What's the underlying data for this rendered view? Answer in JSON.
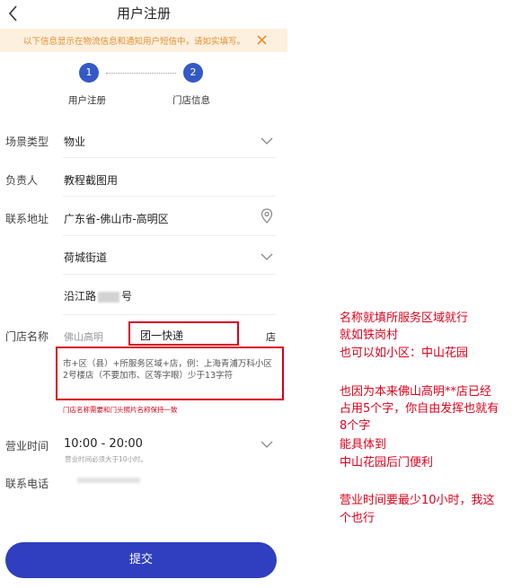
{
  "header": {
    "title": "用户注册"
  },
  "notice": {
    "text": "以下信息显示在物流信息和通知用户短信中，请如实填写。"
  },
  "steps": [
    {
      "number": "1",
      "label": "用户注册"
    },
    {
      "number": "2",
      "label": "门店信息"
    }
  ],
  "form": {
    "scene_type": {
      "label": "场景类型",
      "value": "物业"
    },
    "owner": {
      "label": "负责人",
      "value": "教程截图用"
    },
    "address": {
      "label": "联系地址",
      "region": "广东省-佛山市-高明区",
      "street": "荷城街道",
      "detail_prefix": "沿江路",
      "detail_suffix": "号"
    },
    "store_name": {
      "label": "门店名称",
      "prefix": "佛山高明",
      "input_value": "团一快递",
      "suffix": "店",
      "hint": "市+区（县）+所服务区域+店，例：上海青浦万科小区2号楼店（不要加市、区等字眼）少于13字符",
      "note": "门店名称需要和门头照片名称保持一致"
    },
    "hours": {
      "label": "营业时间",
      "value": "10:00 - 20:00",
      "note": "营业时间必须大于10小时。"
    },
    "phone": {
      "label": "联系电话"
    }
  },
  "submit_label": "提交",
  "annotations": [
    "名称就填所服务区域就行",
    "就如铁岗村",
    "也可以如小区：中山花园",
    "也因为本来佛山高明**店已经",
    "占用5个字，你自由发挥也就有",
    "8个字",
    "能具体到",
    "中山花园后门便利",
    "营业时间要最少10小时，我这",
    "个也行"
  ],
  "colors": {
    "primary": "#3458c6",
    "notice_bg": "#fdf0df",
    "notice_text": "#e4902e",
    "annotation": "#e0001b"
  },
  "icons": [
    "back-icon",
    "close-icon",
    "chevron-down-icon",
    "location-pin-icon"
  ]
}
